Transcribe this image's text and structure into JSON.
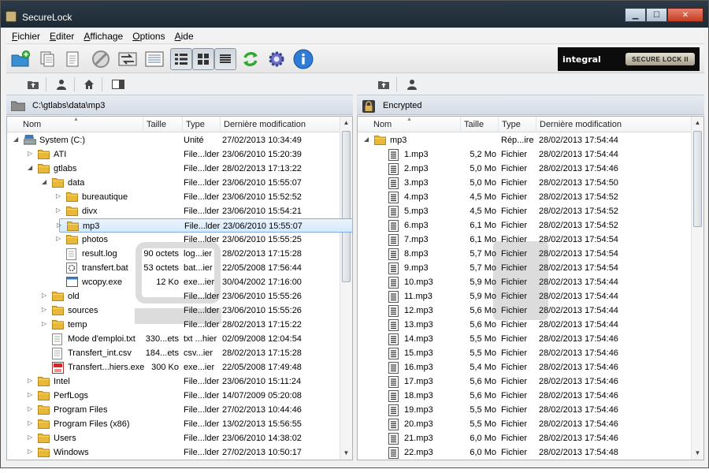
{
  "window": {
    "title": "SecureLock"
  },
  "menu": [
    {
      "key": "F",
      "rest": "ichier"
    },
    {
      "key": "E",
      "rest": "diter"
    },
    {
      "key": "A",
      "rest": "ffichage"
    },
    {
      "key": "O",
      "rest": "ptions"
    },
    {
      "key": "A",
      "rest": "ide"
    }
  ],
  "toolbar": {
    "icons": [
      "new-folder-icon",
      "copy-icon",
      "paste-icon",
      "block-icon",
      "sync-arrows-icon",
      "list-view-icon",
      "details-view-icon",
      "thumbnails-view-icon",
      "lines-view-icon",
      "refresh-icon",
      "settings-gear-icon",
      "info-icon"
    ],
    "logo_brand": "integral",
    "logo_product": "SECURE LOCK II"
  },
  "left": {
    "path": "C:\\gtlabs\\data\\mp3",
    "columns": {
      "name": "Nom",
      "size": "Taille",
      "type": "Type",
      "modified": "Dernière modification"
    },
    "rows": [
      {
        "indent": 0,
        "tri": "◢",
        "icon": "drive",
        "name": "System (C:)",
        "size": "",
        "type": "Unité",
        "modified": "27/02/2013 10:34:49"
      },
      {
        "indent": 1,
        "tri": "▷",
        "icon": "folder",
        "name": "ATI",
        "size": "",
        "type": "File...lder",
        "modified": "23/06/2010 15:20:39"
      },
      {
        "indent": 1,
        "tri": "◢",
        "icon": "folder",
        "name": "gtlabs",
        "size": "",
        "type": "File...lder",
        "modified": "28/02/2013 17:13:22"
      },
      {
        "indent": 2,
        "tri": "◢",
        "icon": "folder",
        "name": "data",
        "size": "",
        "type": "File...lder",
        "modified": "23/06/2010 15:55:07"
      },
      {
        "indent": 3,
        "tri": "▷",
        "icon": "folder",
        "name": "bureautique",
        "size": "",
        "type": "File...lder",
        "modified": "23/06/2010 15:52:52"
      },
      {
        "indent": 3,
        "tri": "▷",
        "icon": "folder",
        "name": "divx",
        "size": "",
        "type": "File...lder",
        "modified": "23/06/2010 15:54:21"
      },
      {
        "indent": 3,
        "tri": "▷",
        "icon": "folder",
        "name": "mp3",
        "size": "",
        "type": "File...lder",
        "modified": "23/06/2010 15:55:07",
        "selected": true
      },
      {
        "indent": 3,
        "tri": "▷",
        "icon": "folder",
        "name": "photos",
        "size": "",
        "type": "File...lder",
        "modified": "23/06/2010 15:55:25"
      },
      {
        "indent": 3,
        "tri": "",
        "icon": "text",
        "name": "result.log",
        "size": "90 octets",
        "type": "log...ier",
        "modified": "28/02/2013 17:15:28"
      },
      {
        "indent": 3,
        "tri": "",
        "icon": "bat",
        "name": "transfert.bat",
        "size": "53 octets",
        "type": "bat...ier",
        "modified": "22/05/2008 17:56:44"
      },
      {
        "indent": 3,
        "tri": "",
        "icon": "exe",
        "name": "wcopy.exe",
        "size": "12 Ko",
        "type": "exe...ier",
        "modified": "30/04/2002 17:16:00"
      },
      {
        "indent": 2,
        "tri": "▷",
        "icon": "folder",
        "name": "old",
        "size": "",
        "type": "File...lder",
        "modified": "23/06/2010 15:55:26"
      },
      {
        "indent": 2,
        "tri": "▷",
        "icon": "folder",
        "name": "sources",
        "size": "",
        "type": "File...lder",
        "modified": "23/06/2010 15:55:26"
      },
      {
        "indent": 2,
        "tri": "▷",
        "icon": "folder",
        "name": "temp",
        "size": "",
        "type": "File...lder",
        "modified": "28/02/2013 17:15:22"
      },
      {
        "indent": 2,
        "tri": "",
        "icon": "text",
        "name": "Mode d'emploi.txt",
        "size": "330...ets",
        "type": "txt ...hier",
        "modified": "02/09/2008 12:04:54"
      },
      {
        "indent": 2,
        "tri": "",
        "icon": "text",
        "name": "Transfert_int.csv",
        "size": "184...ets",
        "type": "csv...ier",
        "modified": "28/02/2013 17:15:28"
      },
      {
        "indent": 2,
        "tri": "",
        "icon": "exe-red",
        "name": "Transfert...hiers.exe",
        "size": "300 Ko",
        "type": "exe...ier",
        "modified": "22/05/2008 17:49:48"
      },
      {
        "indent": 1,
        "tri": "▷",
        "icon": "folder",
        "name": "Intel",
        "size": "",
        "type": "File...lder",
        "modified": "23/06/2010 15:11:24"
      },
      {
        "indent": 1,
        "tri": "▷",
        "icon": "folder",
        "name": "PerfLogs",
        "size": "",
        "type": "File...lder",
        "modified": "14/07/2009 05:20:08"
      },
      {
        "indent": 1,
        "tri": "▷",
        "icon": "folder",
        "name": "Program Files",
        "size": "",
        "type": "File...lder",
        "modified": "27/02/2013 10:44:46"
      },
      {
        "indent": 1,
        "tri": "▷",
        "icon": "folder",
        "name": "Program Files (x86)",
        "size": "",
        "type": "File...lder",
        "modified": "13/02/2013 15:56:55"
      },
      {
        "indent": 1,
        "tri": "▷",
        "icon": "folder",
        "name": "Users",
        "size": "",
        "type": "File...lder",
        "modified": "23/06/2010 14:38:02"
      },
      {
        "indent": 1,
        "tri": "▷",
        "icon": "folder",
        "name": "Windows",
        "size": "",
        "type": "File...lder",
        "modified": "27/02/2013 10:50:17"
      }
    ]
  },
  "right": {
    "path": "Encrypted",
    "columns": {
      "name": "Nom",
      "size": "Taille",
      "type": "Type",
      "modified": "Dernière modification"
    },
    "rows": [
      {
        "indent": 0,
        "tri": "◢",
        "icon": "folder",
        "name": "mp3",
        "size": "",
        "type": "Rép...ire",
        "modified": "28/02/2013 17:54:44"
      },
      {
        "indent": 1,
        "tri": "",
        "icon": "mp3",
        "name": "1.mp3",
        "size": "5,2 Mo",
        "type": "Fichier",
        "modified": "28/02/2013 17:54:44"
      },
      {
        "indent": 1,
        "tri": "",
        "icon": "mp3",
        "name": "2.mp3",
        "size": "5,0 Mo",
        "type": "Fichier",
        "modified": "28/02/2013 17:54:46"
      },
      {
        "indent": 1,
        "tri": "",
        "icon": "mp3",
        "name": "3.mp3",
        "size": "5,0 Mo",
        "type": "Fichier",
        "modified": "28/02/2013 17:54:50"
      },
      {
        "indent": 1,
        "tri": "",
        "icon": "mp3",
        "name": "4.mp3",
        "size": "4,5 Mo",
        "type": "Fichier",
        "modified": "28/02/2013 17:54:52"
      },
      {
        "indent": 1,
        "tri": "",
        "icon": "mp3",
        "name": "5.mp3",
        "size": "4,5 Mo",
        "type": "Fichier",
        "modified": "28/02/2013 17:54:52"
      },
      {
        "indent": 1,
        "tri": "",
        "icon": "mp3",
        "name": "6.mp3",
        "size": "6,1 Mo",
        "type": "Fichier",
        "modified": "28/02/2013 17:54:52"
      },
      {
        "indent": 1,
        "tri": "",
        "icon": "mp3",
        "name": "7.mp3",
        "size": "6,1 Mo",
        "type": "Fichier",
        "modified": "28/02/2013 17:54:54"
      },
      {
        "indent": 1,
        "tri": "",
        "icon": "mp3",
        "name": "8.mp3",
        "size": "5,7 Mo",
        "type": "Fichier",
        "modified": "28/02/2013 17:54:54"
      },
      {
        "indent": 1,
        "tri": "",
        "icon": "mp3",
        "name": "9.mp3",
        "size": "5,7 Mo",
        "type": "Fichier",
        "modified": "28/02/2013 17:54:54"
      },
      {
        "indent": 1,
        "tri": "",
        "icon": "mp3",
        "name": "10.mp3",
        "size": "5,9 Mo",
        "type": "Fichier",
        "modified": "28/02/2013 17:54:44"
      },
      {
        "indent": 1,
        "tri": "",
        "icon": "mp3",
        "name": "11.mp3",
        "size": "5,9 Mo",
        "type": "Fichier",
        "modified": "28/02/2013 17:54:44"
      },
      {
        "indent": 1,
        "tri": "",
        "icon": "mp3",
        "name": "12.mp3",
        "size": "5,6 Mo",
        "type": "Fichier",
        "modified": "28/02/2013 17:54:44"
      },
      {
        "indent": 1,
        "tri": "",
        "icon": "mp3",
        "name": "13.mp3",
        "size": "5,6 Mo",
        "type": "Fichier",
        "modified": "28/02/2013 17:54:44"
      },
      {
        "indent": 1,
        "tri": "",
        "icon": "mp3",
        "name": "14.mp3",
        "size": "5,5 Mo",
        "type": "Fichier",
        "modified": "28/02/2013 17:54:46"
      },
      {
        "indent": 1,
        "tri": "",
        "icon": "mp3",
        "name": "15.mp3",
        "size": "5,5 Mo",
        "type": "Fichier",
        "modified": "28/02/2013 17:54:46"
      },
      {
        "indent": 1,
        "tri": "",
        "icon": "mp3",
        "name": "16.mp3",
        "size": "5,4 Mo",
        "type": "Fichier",
        "modified": "28/02/2013 17:54:46"
      },
      {
        "indent": 1,
        "tri": "",
        "icon": "mp3",
        "name": "17.mp3",
        "size": "5,6 Mo",
        "type": "Fichier",
        "modified": "28/02/2013 17:54:46"
      },
      {
        "indent": 1,
        "tri": "",
        "icon": "mp3",
        "name": "18.mp3",
        "size": "5,6 Mo",
        "type": "Fichier",
        "modified": "28/02/2013 17:54:46"
      },
      {
        "indent": 1,
        "tri": "",
        "icon": "mp3",
        "name": "19.mp3",
        "size": "5,5 Mo",
        "type": "Fichier",
        "modified": "28/02/2013 17:54:46"
      },
      {
        "indent": 1,
        "tri": "",
        "icon": "mp3",
        "name": "20.mp3",
        "size": "5,5 Mo",
        "type": "Fichier",
        "modified": "28/02/2013 17:54:46"
      },
      {
        "indent": 1,
        "tri": "",
        "icon": "mp3",
        "name": "21.mp3",
        "size": "6,0 Mo",
        "type": "Fichier",
        "modified": "28/02/2013 17:54:46"
      },
      {
        "indent": 1,
        "tri": "",
        "icon": "mp3",
        "name": "22.mp3",
        "size": "6,0 Mo",
        "type": "Fichier",
        "modified": "28/02/2013 17:54:48"
      }
    ]
  },
  "colors": {
    "folder": "#e8b83a",
    "selection": "#d5e9fb",
    "titlebar": "#1e2a35",
    "accent": "#2e7cd6"
  }
}
